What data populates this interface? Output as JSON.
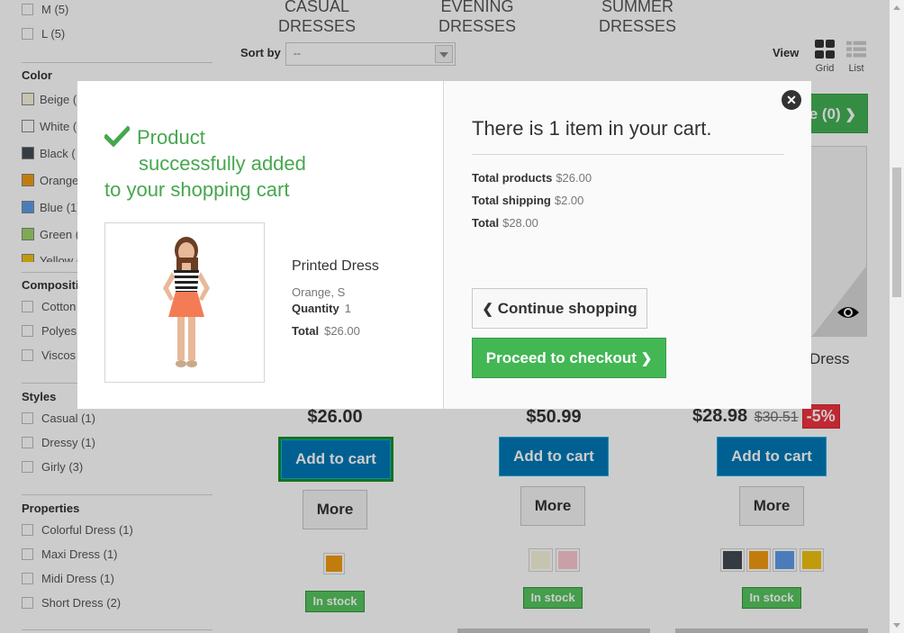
{
  "sidebar": {
    "size_items": [
      {
        "label": "M (5)"
      },
      {
        "label": "L (5)"
      }
    ],
    "color_heading": "Color",
    "color_items": [
      {
        "label": "Beige (",
        "color": "#f5f5dc"
      },
      {
        "label": "White (",
        "color": "#ffffff"
      },
      {
        "label": "Black (",
        "color": "#434a54"
      },
      {
        "label": "Orange",
        "color": "#f39c11"
      },
      {
        "label": "Blue (1)",
        "color": "#5d9cec"
      },
      {
        "label": "Green (",
        "color": "#a0d468"
      },
      {
        "label": "Yellow (",
        "color": "#f1c40f"
      }
    ],
    "composition_heading": "Compositio",
    "composition_items": [
      {
        "label": "Cotton"
      },
      {
        "label": "Polyes"
      },
      {
        "label": "Viscos"
      }
    ],
    "styles_heading": "Styles",
    "styles_items": [
      {
        "label": "Casual (1)"
      },
      {
        "label": "Dressy (1)"
      },
      {
        "label": "Girly (3)"
      }
    ],
    "properties_heading": "Properties",
    "properties_items": [
      {
        "label": "Colorful Dress (1)"
      },
      {
        "label": "Maxi Dress (1)"
      },
      {
        "label": "Midi Dress (1)"
      },
      {
        "label": "Short Dress (2)"
      }
    ]
  },
  "categories": [
    {
      "line1": "CASUAL",
      "line2": "DRESSES"
    },
    {
      "line1": "EVENING",
      "line2": "DRESSES"
    },
    {
      "line1": "SUMMER",
      "line2": "DRESSES"
    }
  ],
  "toolbar": {
    "sort_label": "Sort by",
    "sort_value": "--",
    "view_label": "View",
    "grid_label": "Grid",
    "list_label": "List"
  },
  "compare_button": {
    "label": "e (0)"
  },
  "products": [
    {
      "price": "$26.00",
      "add_label": "Add to cart",
      "more_label": "More",
      "stock": "In stock",
      "colors": [
        "#f39c11"
      ]
    },
    {
      "price": "$50.99",
      "add_label": "Add to cart",
      "more_label": "More",
      "stock": "In stock",
      "colors": [
        "#f5f5dc",
        "#fcc8d1"
      ]
    },
    {
      "price": "$28.98",
      "old_price": "$30.51",
      "reduction": "-5%",
      "name_fragment": "Dress",
      "add_label": "Add to cart",
      "more_label": "More",
      "stock": "In stock",
      "colors": [
        "#434a54",
        "#f39c11",
        "#5d9cec",
        "#f1c40f"
      ]
    }
  ],
  "modal": {
    "success_line1": "Product",
    "success_line2": "successfully added",
    "success_line3": "to your shopping cart",
    "product_name": "Printed Dress",
    "product_attributes": "Orange, S",
    "quantity_label": "Quantity",
    "quantity_value": "1",
    "total_label": "Total",
    "total_value": "$26.00",
    "cart_heading": "There is 1 item in your cart.",
    "total_products_label": "Total products",
    "total_products_value": "$26.00",
    "total_shipping_label": "Total shipping",
    "total_shipping_value": "$2.00",
    "cart_total_label": "Total",
    "cart_total_value": "$28.00",
    "continue_label": "Continue shopping",
    "checkout_label": "Proceed to checkout"
  },
  "colors": {
    "success_green": "#46a74e",
    "cart_blue": "#0079b6",
    "checkout_green": "#43b754",
    "reduction_red": "#f13340"
  }
}
